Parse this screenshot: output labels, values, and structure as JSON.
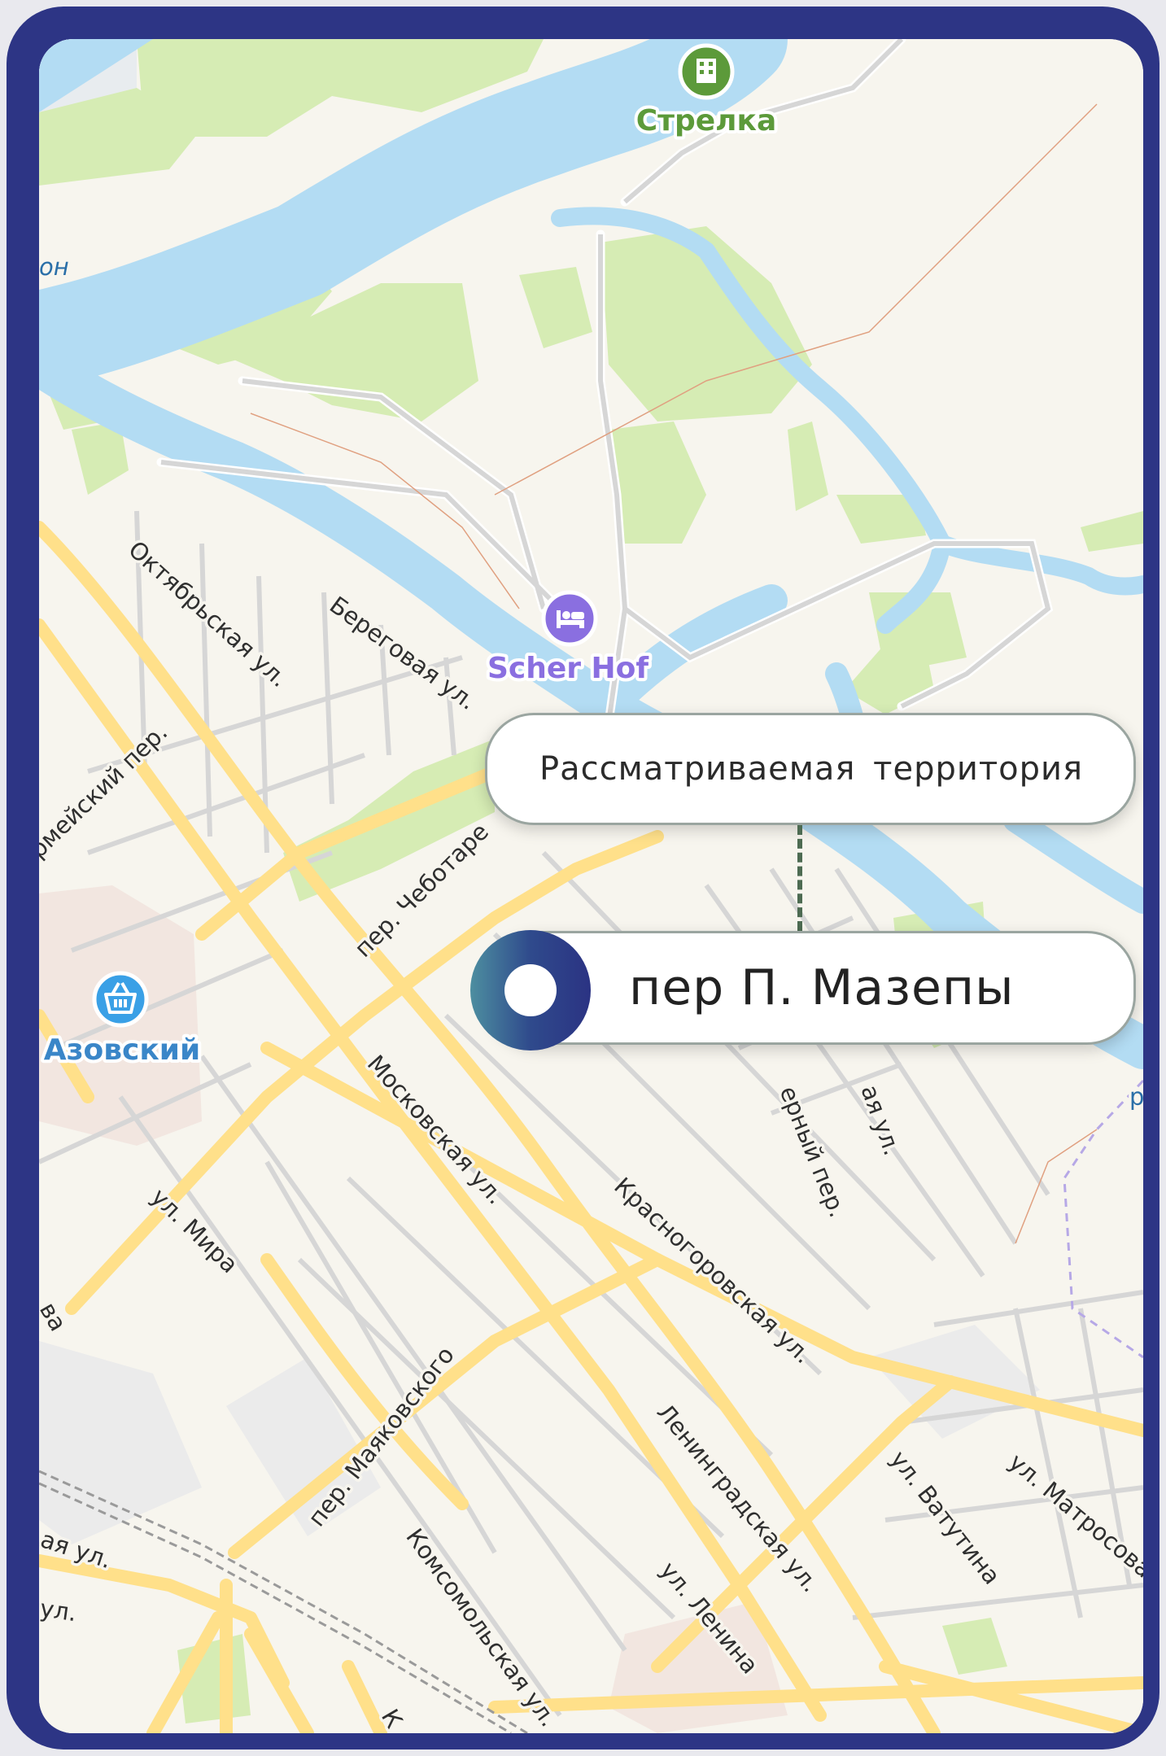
{
  "colors": {
    "frame": "#2d3585",
    "water": "#b3dcf3",
    "park": "#d6ecb4",
    "major_road": "#ffe08a",
    "minor_road": "#d9d9d9",
    "poi_green": "#5c9a3a",
    "poi_purple": "#8a6fe0",
    "poi_blue": "#3aa0e6"
  },
  "pois": [
    {
      "id": "strelka",
      "label": "Стрелка",
      "icon": "building-icon"
    },
    {
      "id": "scher-hof",
      "label": "Scher Hof",
      "icon": "bed-icon"
    },
    {
      "id": "azovsky",
      "label": "Азовский",
      "icon": "shopping-basket-icon"
    }
  ],
  "streets": [
    "Октябрьская ул.",
    "Береговая ул.",
    "рмейский пер.",
    "пер. Чеботаре",
    "Московская ул.",
    "Красногоровская ул.",
    "ул. Мира",
    "пер. Маяковского",
    "Ленинградская ул.",
    "ул. Ватутина",
    "ул. Матросова",
    "Комсомольская ул.",
    "ул. Ленина",
    "ерный пер.",
    "ая ул.",
    "ая ул.",
    "ул.",
    "ва",
    "он",
    "К",
    "р"
  ],
  "callouts": {
    "territory": "Рассматриваемая  территория",
    "address": "пер П. Мазепы"
  }
}
